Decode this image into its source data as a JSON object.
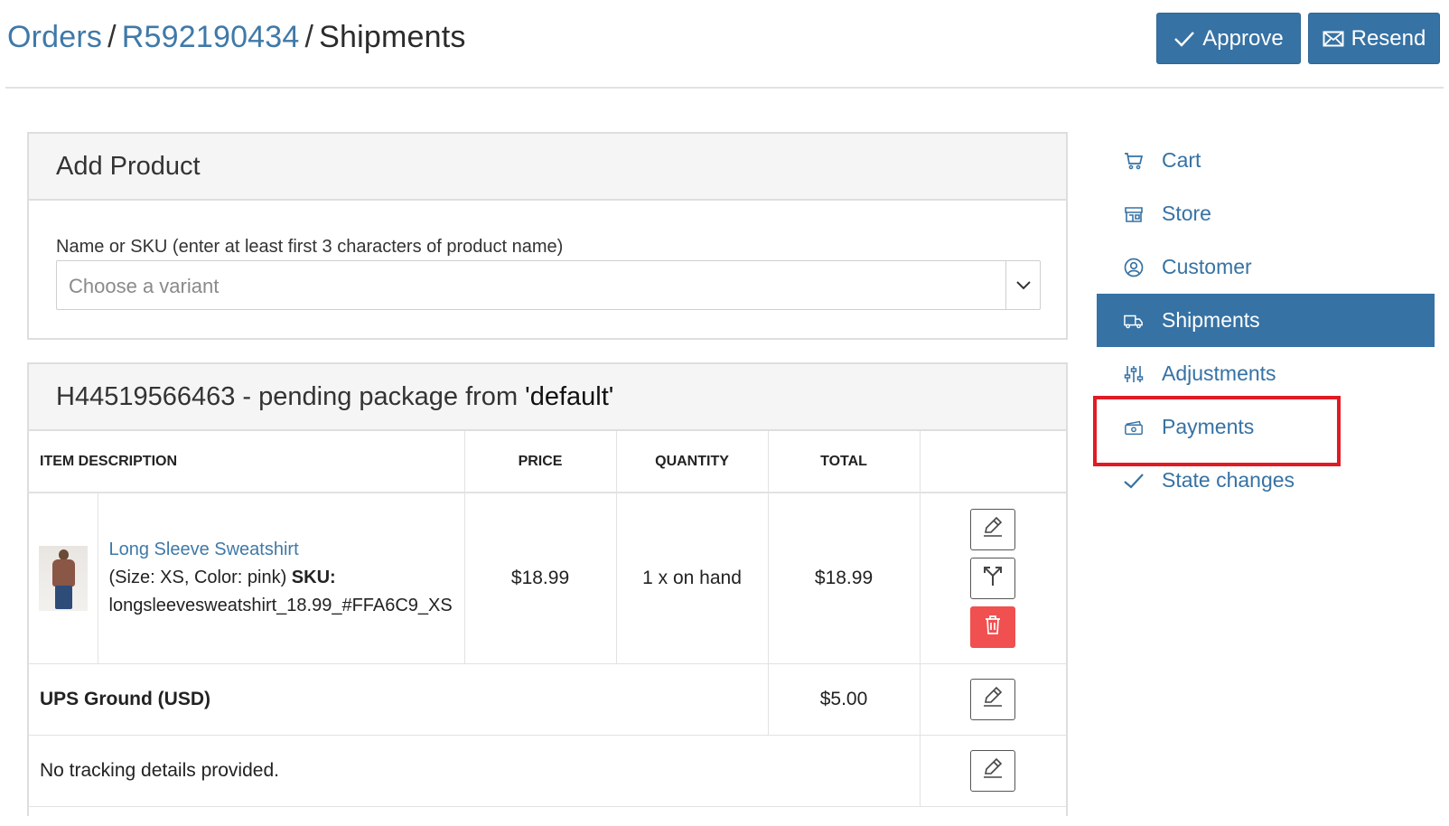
{
  "breadcrumb": {
    "orders": "Orders",
    "separator": "/",
    "order_number": "R592190434",
    "current": "Shipments"
  },
  "actions": {
    "approve_label": "Approve",
    "resend_label": "Resend"
  },
  "add_product": {
    "title": "Add Product",
    "field_label": "Name or SKU (enter at least first 3 characters of product name)",
    "placeholder": "Choose a variant"
  },
  "shipment": {
    "title_prefix": "H44519566463 - pending package from ",
    "stock_location": "'default'",
    "columns": {
      "item_description": "Item Description",
      "price": "Price",
      "quantity": "Quantity",
      "total": "Total"
    },
    "item": {
      "name": "Long Sleeve Sweatshirt",
      "options": "(Size: XS, Color: pink)",
      "sku_label": "SKU:",
      "sku": "longsleevesweatshirt_18.99_#FFA6C9_XS",
      "price": "$18.99",
      "quantity": "1 x on hand",
      "total": "$18.99"
    },
    "shipping_method": "UPS Ground (USD)",
    "shipping_cost": "$5.00",
    "tracking": "No tracking details provided."
  },
  "sidebar": {
    "items": [
      {
        "label": "Cart",
        "icon": "cart-icon",
        "active": false
      },
      {
        "label": "Store",
        "icon": "store-icon",
        "active": false
      },
      {
        "label": "Customer",
        "icon": "user-circle-icon",
        "active": false
      },
      {
        "label": "Shipments",
        "icon": "truck-icon",
        "active": true
      },
      {
        "label": "Adjustments",
        "icon": "sliders-icon",
        "active": false
      },
      {
        "label": "Payments",
        "icon": "cash-icon",
        "active": false
      },
      {
        "label": "State changes",
        "icon": "check-icon",
        "active": false
      }
    ]
  },
  "colors": {
    "primary": "#3672a4",
    "link": "#3f79a8",
    "danger": "#f05050",
    "highlight": "#e01b24"
  }
}
